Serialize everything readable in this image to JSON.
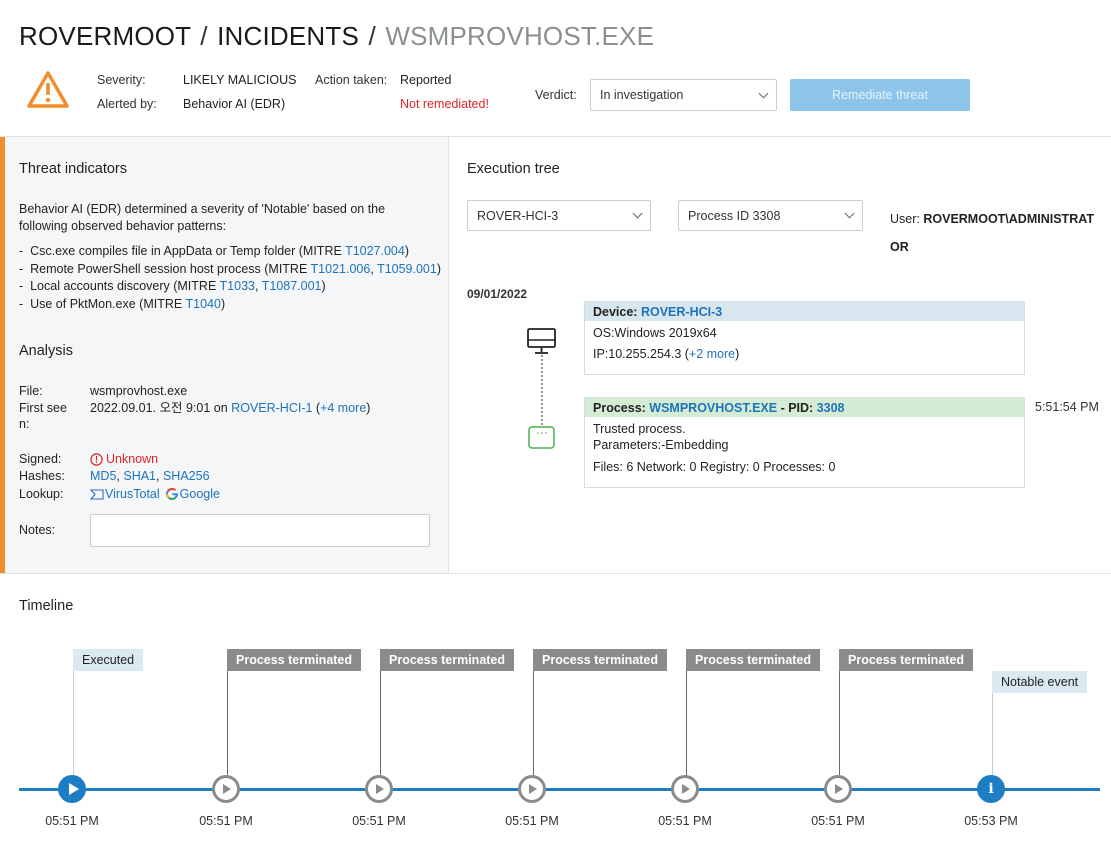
{
  "breadcrumb": {
    "org": "ROVERMOOT",
    "section": "INCIDENTS",
    "current": "WSMPROVHOST.EXE",
    "sep": "/"
  },
  "header": {
    "severity_label": "Severity:",
    "severity_value": "LIKELY MALICIOUS",
    "alerted_label": "Alerted by:",
    "alerted_value": "Behavior AI (EDR)",
    "action_label": "Action taken:",
    "action_value": "Reported",
    "remediation_status": "Not remediated!",
    "verdict_label": "Verdict:",
    "verdict_value": "In investigation",
    "remediate_button": "Remediate threat",
    "warning_icon": "warning-triangle-icon",
    "warning_color": "#f18e2c"
  },
  "threat_indicators": {
    "title": "Threat indicators",
    "intro_line1": "Behavior AI (EDR) determined a severity of 'Notable' based on the",
    "intro_line2": "following observed behavior patterns:",
    "items": [
      {
        "text": "Csc.exe compiles file in AppData or Temp folder (MITRE ",
        "links": [
          "T1027.004"
        ],
        "close": ")"
      },
      {
        "text": "Remote PowerShell session host process (MITRE ",
        "links": [
          "T1021.006",
          "T1059.001"
        ],
        "close": ")"
      },
      {
        "text": "Local accounts discovery (MITRE ",
        "links": [
          "T1033",
          "T1087.001"
        ],
        "close": ")"
      },
      {
        "text": "Use of PktMon.exe (MITRE ",
        "links": [
          "T1040"
        ],
        "close": ")"
      }
    ]
  },
  "analysis": {
    "title": "Analysis",
    "file_label": "File:",
    "file_value": "wsmprovhost.exe",
    "first_seen_label_1": "First see",
    "first_seen_label_2": "n:",
    "first_seen_value": "2022.09.01. 오전 9:01 on ",
    "first_seen_host": "ROVER-HCI-1",
    "first_seen_more": "+4 more",
    "signed_label": "Signed:",
    "signed_value": "Unknown",
    "hashes_label": "Hashes:",
    "hashes": [
      "MD5",
      "SHA1",
      "SHA256"
    ],
    "lookup_label": "Lookup:",
    "lookup_virustotal": "VirusTotal",
    "lookup_google": "Google",
    "notes_label": "Notes:",
    "notes_value": ""
  },
  "execution_tree": {
    "title": "Execution tree",
    "host_select": "ROVER-HCI-3",
    "process_select": "Process ID 3308",
    "user_label": "User:",
    "user_value": "ROVERMOOT\\ADMINISTRATOR",
    "date": "09/01/2022",
    "device": {
      "head_label": "Device:",
      "name": "ROVER-HCI-3",
      "os": "OS:Windows 2019x64",
      "ip": "IP:10.255.254.3",
      "ip_more": "+2 more"
    },
    "process": {
      "head_label": "Process:",
      "name": "WSMPROVHOST.EXE",
      "pid_label": "- PID:",
      "pid": "3308",
      "trust": "Trusted process.",
      "params": "Parameters:-Embedding",
      "counts": "Files: 6 Network: 0 Registry: 0 Processes: 0",
      "time": "5:51:54 PM"
    }
  },
  "timeline": {
    "title": "Timeline",
    "events": [
      {
        "label": "Executed",
        "time": "05:51 PM",
        "kind": "executed",
        "icon": "play-icon"
      },
      {
        "label": "Process terminated",
        "time": "05:51 PM",
        "kind": "terminated",
        "icon": "play-icon"
      },
      {
        "label": "Process terminated",
        "time": "05:51 PM",
        "kind": "terminated",
        "icon": "play-icon"
      },
      {
        "label": "Process terminated",
        "time": "05:51 PM",
        "kind": "terminated",
        "icon": "play-icon"
      },
      {
        "label": "Process terminated",
        "time": "05:51 PM",
        "kind": "terminated",
        "icon": "play-icon"
      },
      {
        "label": "Process terminated",
        "time": "05:51 PM",
        "kind": "terminated",
        "icon": "play-icon"
      },
      {
        "label": "Notable event",
        "time": "05:53 PM",
        "kind": "notable",
        "icon": "info-icon"
      }
    ],
    "accent": "#1e7ec4"
  }
}
